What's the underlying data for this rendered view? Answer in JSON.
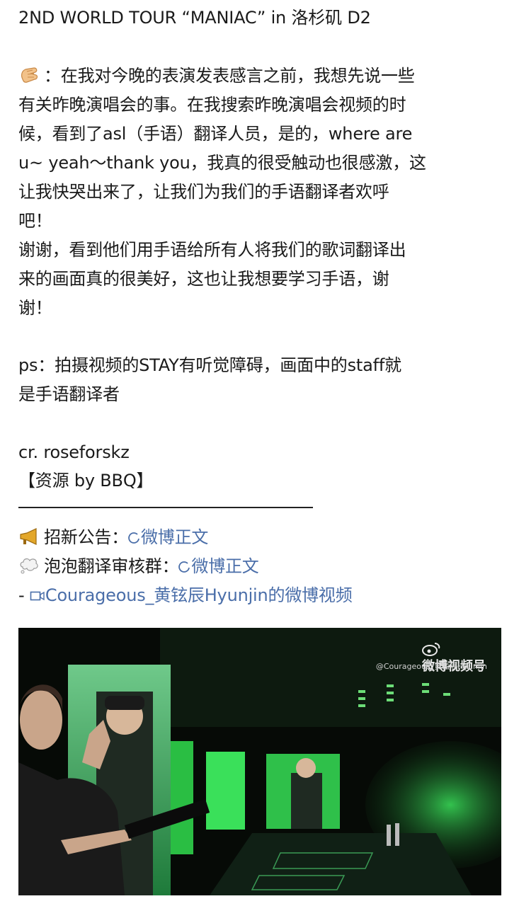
{
  "post": {
    "title": "2ND WORLD TOUR “MANIAC” in 洛杉矶 D2",
    "p1": [
      "：在我对今晚的表演发表感言之前，我想先说一些",
      "有关昨晚演唱会的事。在我搜索昨晚演唱会视频的时",
      "候，看到了asl（手语）翻译人员，是的，where are",
      "u~ yeah～thank you，我真的很受触动也很感激，这",
      "让我快哭出来了，让我们为我们的手语翻译者欢呼",
      "吧！"
    ],
    "p2": [
      "谢谢，看到他们用手语给所有人将我们的歌词翻译出",
      "来的画面真的很美好，这也让我想要学习手语，谢",
      "谢！"
    ],
    "ps": [
      "ps：拍摄视频的STAY有听觉障碍，画面中的staff就",
      "是手语翻译者"
    ],
    "credit": "cr. roseforskz",
    "source": "【资源 by BBQ】",
    "recruit_label": "招新公告：",
    "recruit_link": "微博正文",
    "bubble_label": "泡泡翻译审核群：",
    "bubble_link": "微博正文",
    "video_prefix": "- ",
    "video_link": "Courageous_黄铉辰Hyunjin的微博视频"
  },
  "icons": {
    "lead_emoji": "waving-hand-icon",
    "recruit_emoji": "megaphone-icon",
    "bubble_emoji": "thought-bubble-icon",
    "link_icon": "link-circle-icon",
    "video_icon": "video-icon"
  },
  "media": {
    "watermark": "微博视频号",
    "handle": "@Courageous_黄铉辰Hyunjin"
  },
  "colors": {
    "text": "#1a1a1a",
    "link": "#4a6ea9",
    "stage_green": "#2fd14a"
  }
}
